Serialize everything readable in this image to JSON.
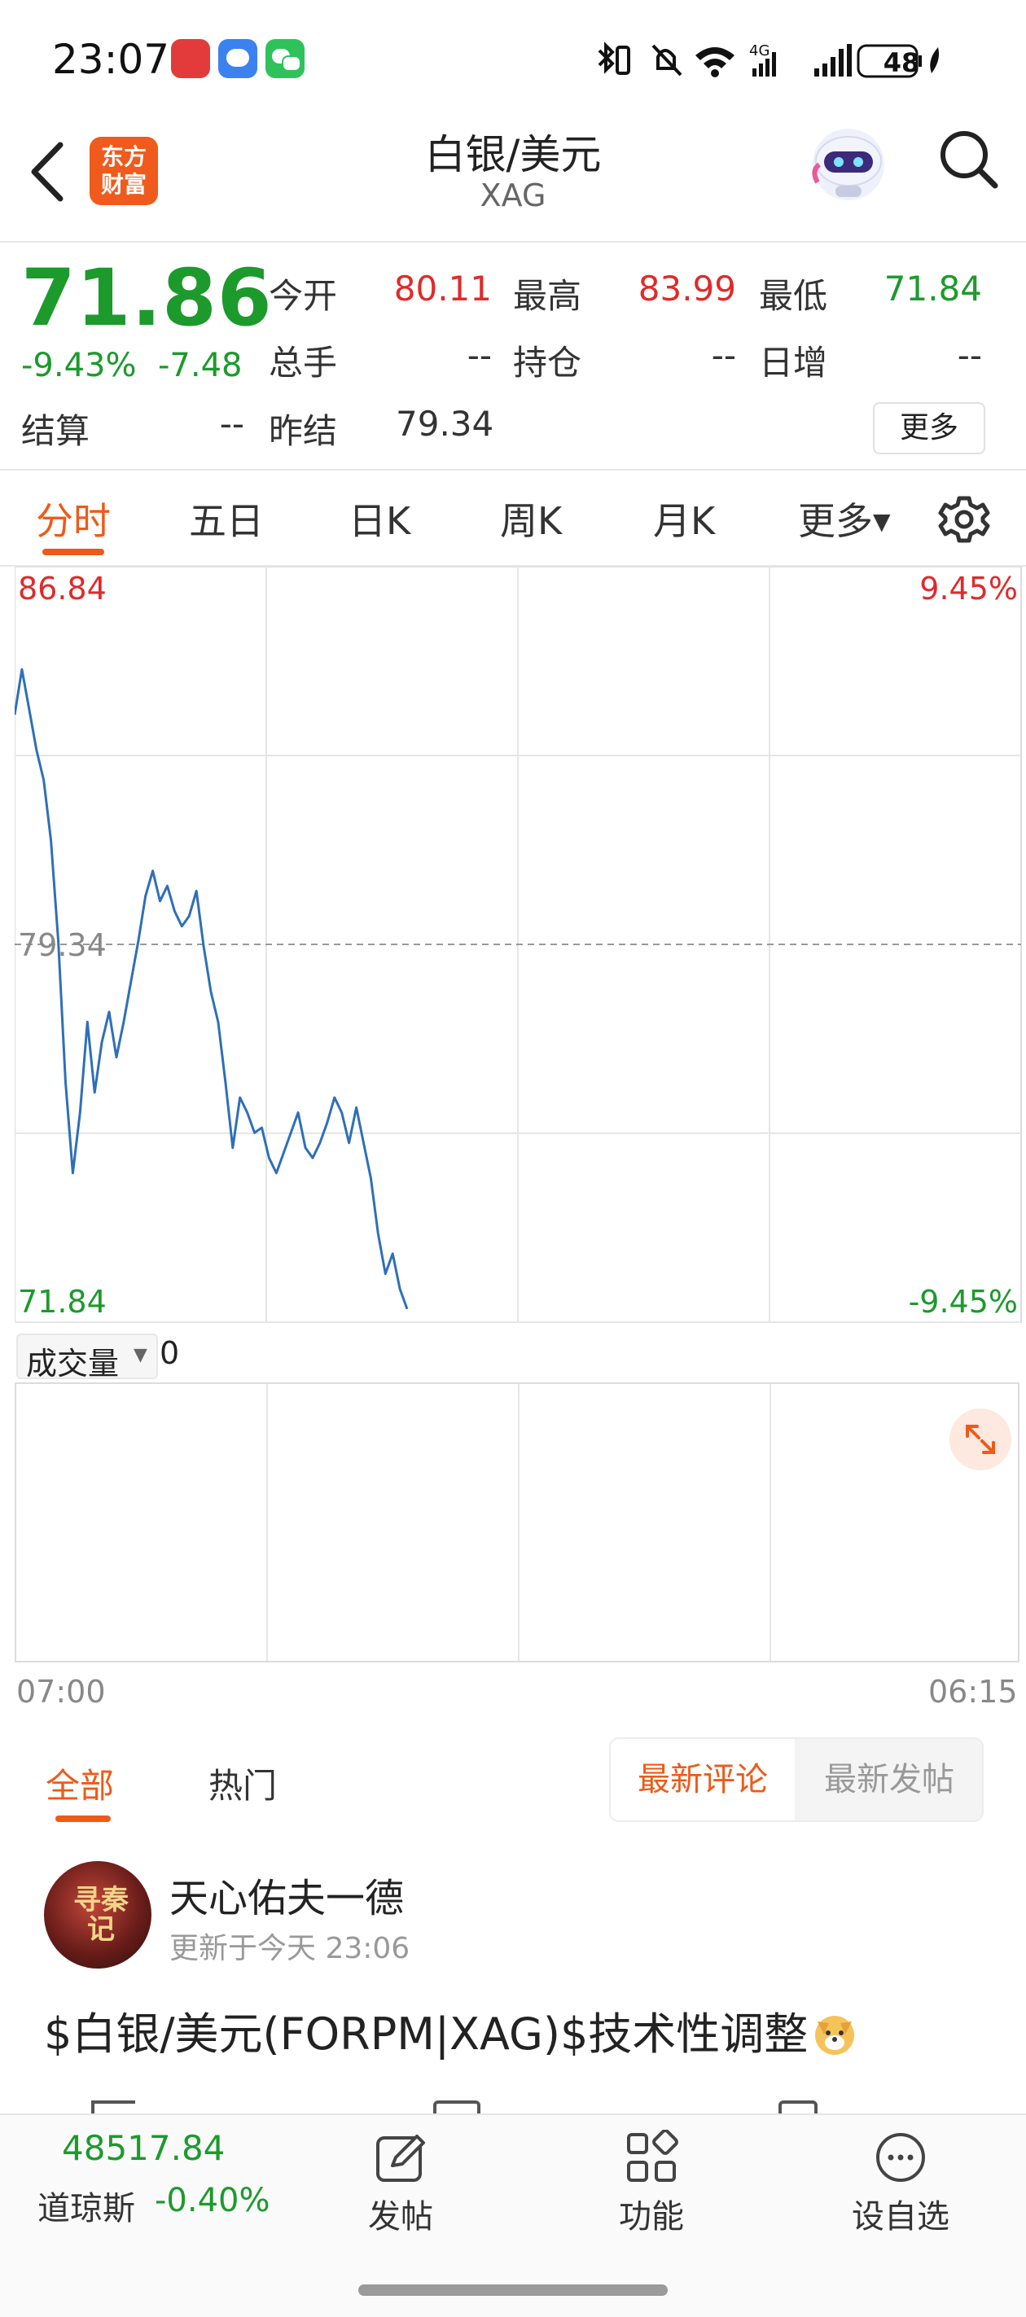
{
  "status_bar": {
    "time": "23:07",
    "battery": "48"
  },
  "header": {
    "brand": "东方财富",
    "title": "白银/美元",
    "subtitle": "XAG"
  },
  "quote": {
    "price": "71.86",
    "change_pct": "-9.43%",
    "change": "-7.48",
    "open_label": "今开",
    "open": "80.11",
    "high_label": "最高",
    "high": "83.99",
    "low_label": "最低",
    "low": "71.84",
    "volume_label": "总手",
    "volume": "--",
    "oi_label": "持仓",
    "oi": "--",
    "daily_inc_label": "日增",
    "daily_inc": "--",
    "settle_label": "结算",
    "settle": "--",
    "prev_settle_label": "昨结",
    "prev_settle": "79.34",
    "more_button": "更多"
  },
  "tabs": [
    "分时",
    "五日",
    "日K",
    "周K",
    "月K",
    "更多"
  ],
  "chart_data": {
    "type": "line",
    "y_max_label": "86.84",
    "y_min_label": "71.84",
    "y_mid_label": "79.34",
    "pct_max_label": "9.45%",
    "pct_min_label": "-9.45%",
    "x_start": "07:00",
    "x_end": "06:15",
    "ylim": [
      71.84,
      86.84
    ],
    "reference": 79.34,
    "grid": true,
    "color": "#2f6fb8",
    "values": [
      83.9,
      84.8,
      84.0,
      83.2,
      82.6,
      81.4,
      79.4,
      76.6,
      74.8,
      76.0,
      77.8,
      76.4,
      77.4,
      78.0,
      77.1,
      77.8,
      78.6,
      79.4,
      80.3,
      80.8,
      80.2,
      80.5,
      80.0,
      79.7,
      79.9,
      80.4,
      79.3,
      78.4,
      77.8,
      76.6,
      75.3,
      76.3,
      76.0,
      75.6,
      75.7,
      75.1,
      74.8,
      75.2,
      75.6,
      76.0,
      75.3,
      75.1,
      75.4,
      75.8,
      76.3,
      76.0,
      75.4,
      76.1,
      75.4,
      74.7,
      73.6,
      72.8,
      73.2,
      72.5,
      72.1
    ],
    "volume_label": "成交量",
    "volume_value": "0"
  },
  "comments": {
    "tab_all": "全部",
    "tab_hot": "热门",
    "seg_latest_comment": "最新评论",
    "seg_latest_post": "最新发帖"
  },
  "post": {
    "avatar_text": "寻秦记",
    "username": "天心佑夫一德",
    "updated": "更新于今天 23:06",
    "text": "$白银/美元(FORPM|XAG)$技术性调整"
  },
  "bottom_bar": {
    "index_value": "48517.84",
    "index_name": "道琼斯",
    "index_change": "-0.40%",
    "post_label": "发帖",
    "function_label": "功能",
    "watchlist_label": "设自选"
  }
}
